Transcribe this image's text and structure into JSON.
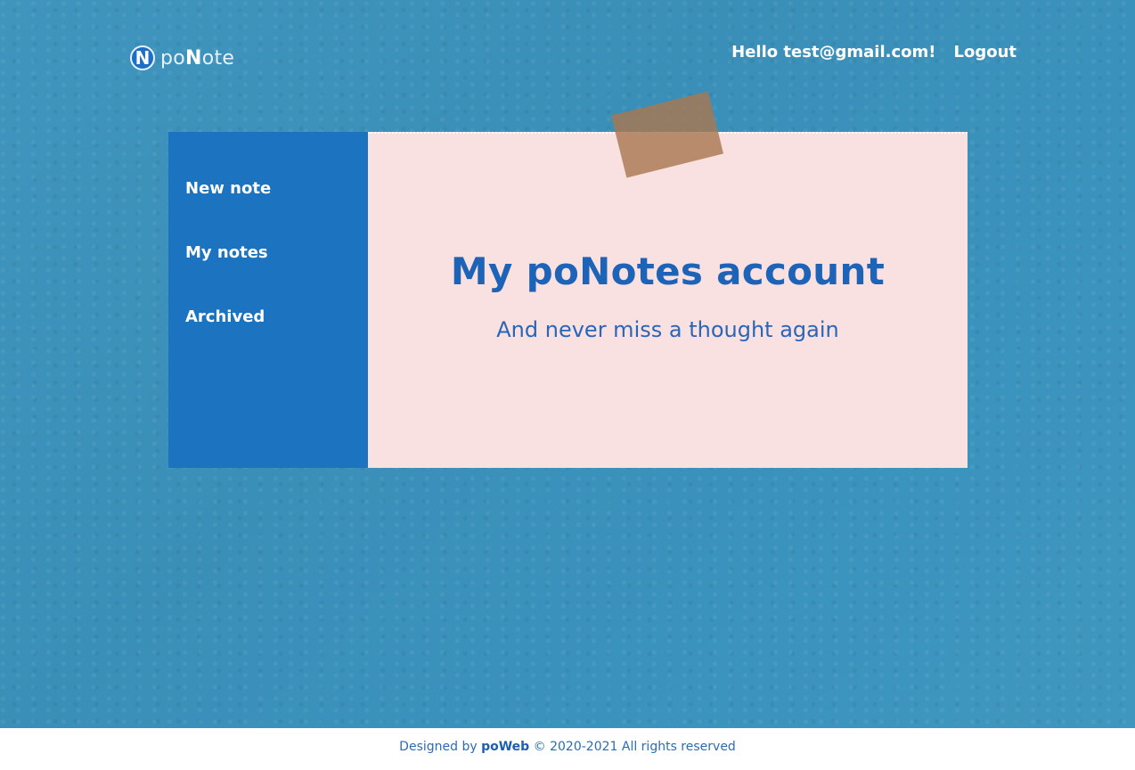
{
  "brand": {
    "mark": "N",
    "name_prefix": "po",
    "name_strong": "N",
    "name_suffix": "ote"
  },
  "header": {
    "greeting": "Hello test@gmail.com!",
    "logout_label": "Logout"
  },
  "sidebar": {
    "items": [
      {
        "label": "New note"
      },
      {
        "label": "My notes"
      },
      {
        "label": "Archived"
      }
    ]
  },
  "main": {
    "title": "My poNotes account",
    "subtitle": "And never miss a thought again"
  },
  "footer": {
    "prefix": "Designed by",
    "brand": "poWeb",
    "suffix": "© 2020-2021 All rights reserved"
  },
  "colors": {
    "wall": "#3a8fb8",
    "sidebar": "#1c74c0",
    "note": "#f8e1e0",
    "accent": "#1d63b8",
    "tape": "#a87852"
  }
}
